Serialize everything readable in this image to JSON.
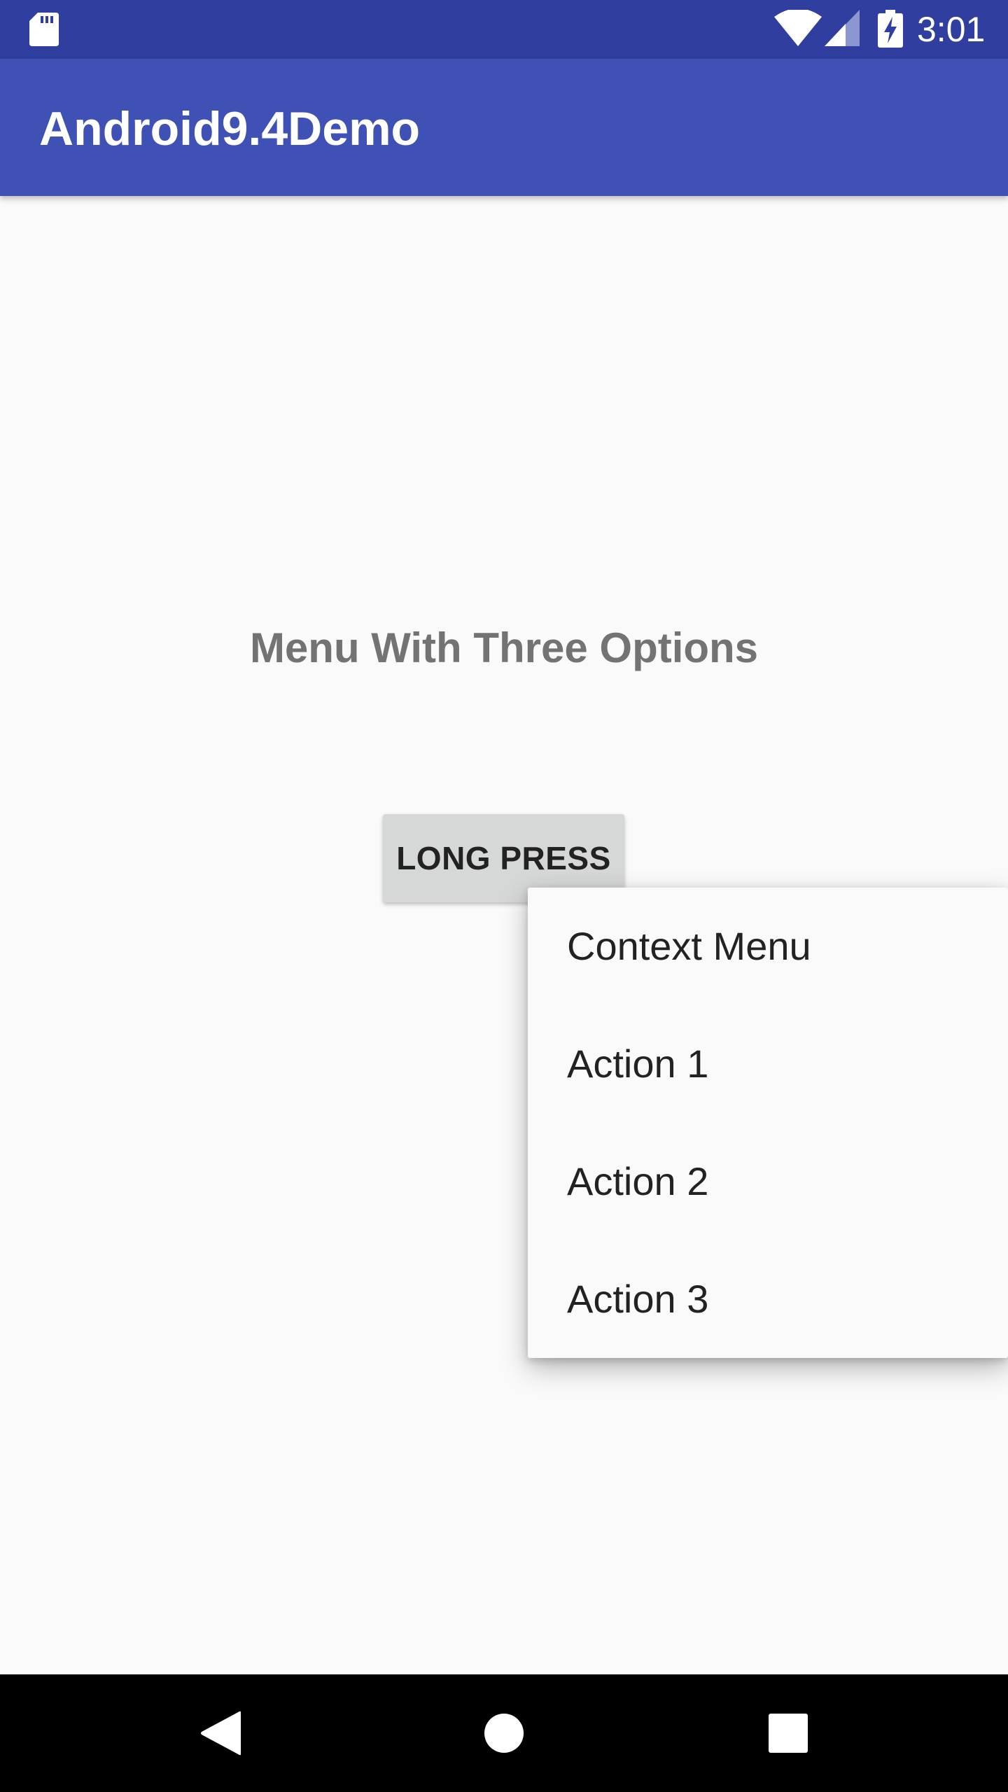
{
  "status_bar": {
    "time": "3:01",
    "icons": [
      "sd-card-icon",
      "wifi-icon",
      "cell-signal-icon",
      "battery-charging-icon"
    ]
  },
  "app_bar": {
    "title": "Android9.4Demo",
    "color": "#3f51b5"
  },
  "main": {
    "heading": "Menu With Three Options",
    "button_label": "LONG PRESS"
  },
  "context_menu": {
    "title": "Context Menu",
    "items": [
      "Action 1",
      "Action 2",
      "Action 3"
    ]
  },
  "nav_bar": {
    "icons": [
      "back-icon",
      "home-icon",
      "recents-icon"
    ]
  },
  "colors": {
    "status_bar": "#303f9f",
    "app_bar": "#3f51b5",
    "background": "#fafafa",
    "heading_text": "#737373",
    "button": "#d6d7d7"
  }
}
